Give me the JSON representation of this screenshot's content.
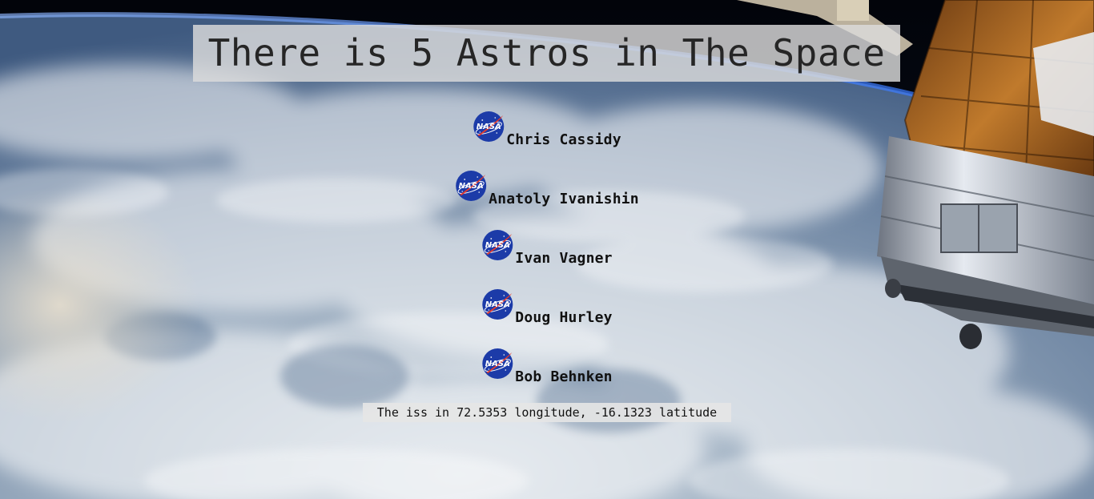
{
  "header": {
    "title": "There is 5 Astros in The Space"
  },
  "astronauts": [
    {
      "name": "Chris Cassidy",
      "icon": "nasa-logo-icon"
    },
    {
      "name": "Anatoly Ivanishin",
      "icon": "nasa-logo-icon"
    },
    {
      "name": "Ivan Vagner",
      "icon": "nasa-logo-icon"
    },
    {
      "name": "Doug Hurley",
      "icon": "nasa-logo-icon"
    },
    {
      "name": "Bob Behnken",
      "icon": "nasa-logo-icon"
    }
  ],
  "iss": {
    "text": "The iss in 72.5353 longitude, -16.1323 latitude"
  },
  "logo": {
    "label": "NASA"
  },
  "colors": {
    "nasa_blue": "#1c3ba8",
    "nasa_red": "#e23b2e",
    "title_bg": "#dcdcdc"
  }
}
